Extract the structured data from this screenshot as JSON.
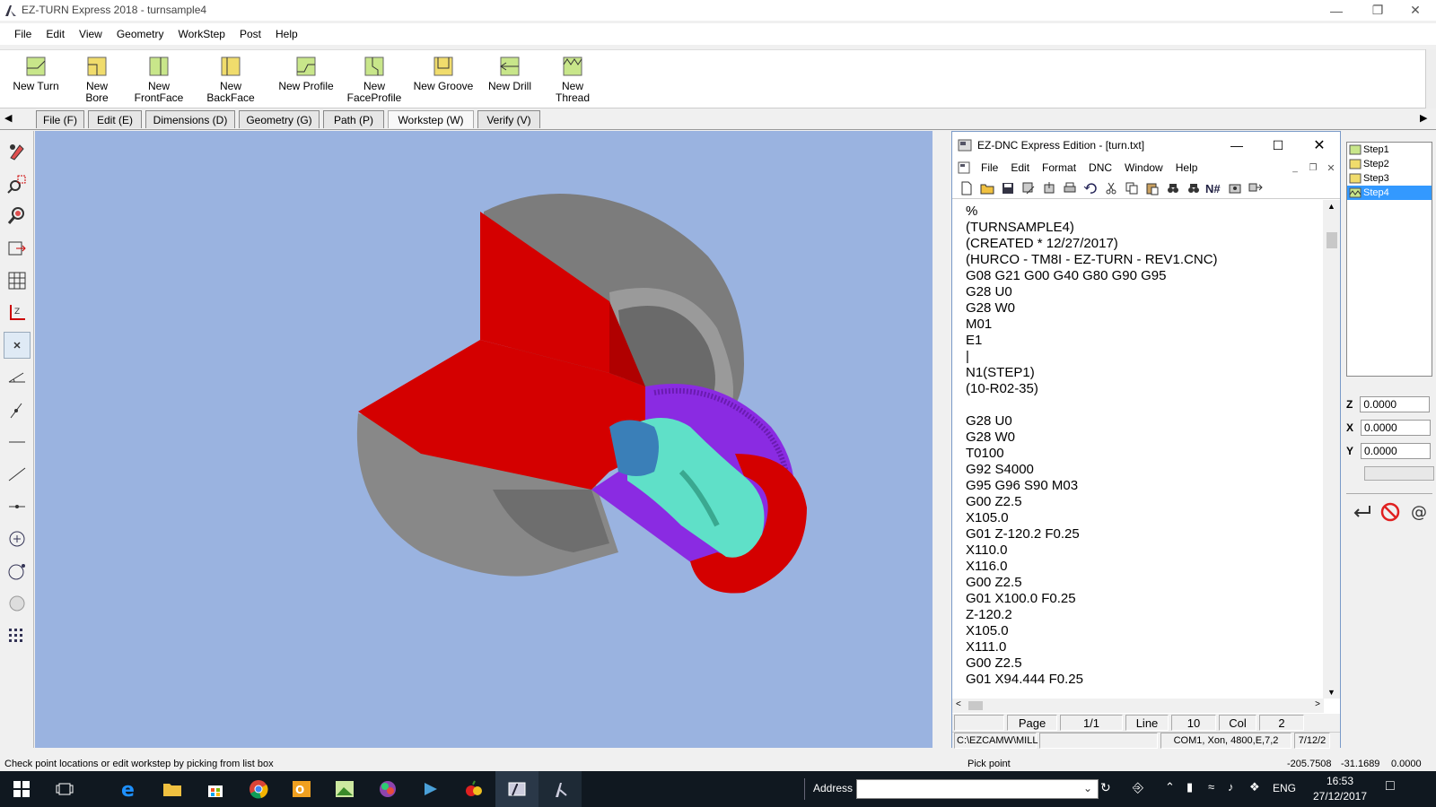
{
  "window": {
    "title": "EZ-TURN Express 2018 - turnsample4"
  },
  "menu": [
    "File",
    "Edit",
    "View",
    "Geometry",
    "WorkStep",
    "Post",
    "Help"
  ],
  "ribbon": [
    {
      "line1": "New Turn",
      "line2": ""
    },
    {
      "line1": "New Bore",
      "line2": ""
    },
    {
      "line1": "New",
      "line2": "FrontFace"
    },
    {
      "line1": "New BackFace",
      "line2": ""
    },
    {
      "line1": "New Profile",
      "line2": ""
    },
    {
      "line1": "New",
      "line2": "FaceProfile"
    },
    {
      "line1": "New Groove",
      "line2": ""
    },
    {
      "line1": "New Drill",
      "line2": ""
    },
    {
      "line1": "New Thread",
      "line2": ""
    }
  ],
  "tabs": [
    "File (F)",
    "Edit (E)",
    "Dimensions (D)",
    "Geometry (G)",
    "Path (P)",
    "Workstep (W)",
    "Verify (V)"
  ],
  "active_tab": "Workstep (W)",
  "dnc": {
    "title": "EZ-DNC  Express Edition - [turn.txt]",
    "menu": [
      "File",
      "Edit",
      "Format",
      "DNC",
      "Window",
      "Help"
    ],
    "code_lines": [
      "%",
      "(TURNSAMPLE4)",
      "(CREATED * 12/27/2017)",
      "(HURCO - TM8I - EZ-TURN - REV1.CNC)",
      "G08 G21 G00 G40 G80 G90 G95",
      "G28 U0",
      "G28 W0",
      "M01",
      "E1",
      "|",
      "N1(STEP1)",
      "(10-R02-35)",
      "",
      "G28 U0",
      "G28 W0",
      "T0100",
      "G92 S4000",
      "G95 G96 S90 M03",
      "G00 Z2.5",
      "X105.0",
      "G01 Z-120.2 F0.25",
      "X110.0",
      "X116.0",
      "G00 Z2.5",
      "G01 X100.0 F0.25",
      "Z-120.2",
      "X105.0",
      "X111.0",
      "G00 Z2.5",
      "G01 X94.444 F0.25"
    ],
    "status": {
      "page_label": "Page",
      "page": "1/1",
      "line_label": "Line",
      "line": "10",
      "col_label": "Col",
      "col": "2"
    },
    "status2": {
      "path": "C:\\EZCAMW\\MILL",
      "com": "COM1, Xon, 4800,E,7,2",
      "date": "7/12/2"
    }
  },
  "steps": [
    "Step1",
    "Step2",
    "Step3",
    "Step4"
  ],
  "selected_step": "Step4",
  "coords": {
    "z_label": "Z",
    "z": "0.0000",
    "x_label": "X",
    "x": "0.0000",
    "y_label": "Y",
    "y": "0.0000"
  },
  "statusbar": {
    "hint": "Check point locations or edit workstep by picking from list box",
    "mode": "Pick point",
    "pos1": "-205.7508",
    "pos2": "-31.1689",
    "pos3": "0.0000"
  },
  "taskbar": {
    "address_label": "Address",
    "lang": "ENG",
    "time": "16:53",
    "date": "27/12/2017"
  },
  "colors": {
    "viewport_bg": "#9ab3e0",
    "part_red": "#d40000",
    "part_gray": "#8a8a8a",
    "thread_purple": "#8a2be2",
    "insert_teal": "#5fe0c8",
    "step_selected": "#3399ff"
  }
}
